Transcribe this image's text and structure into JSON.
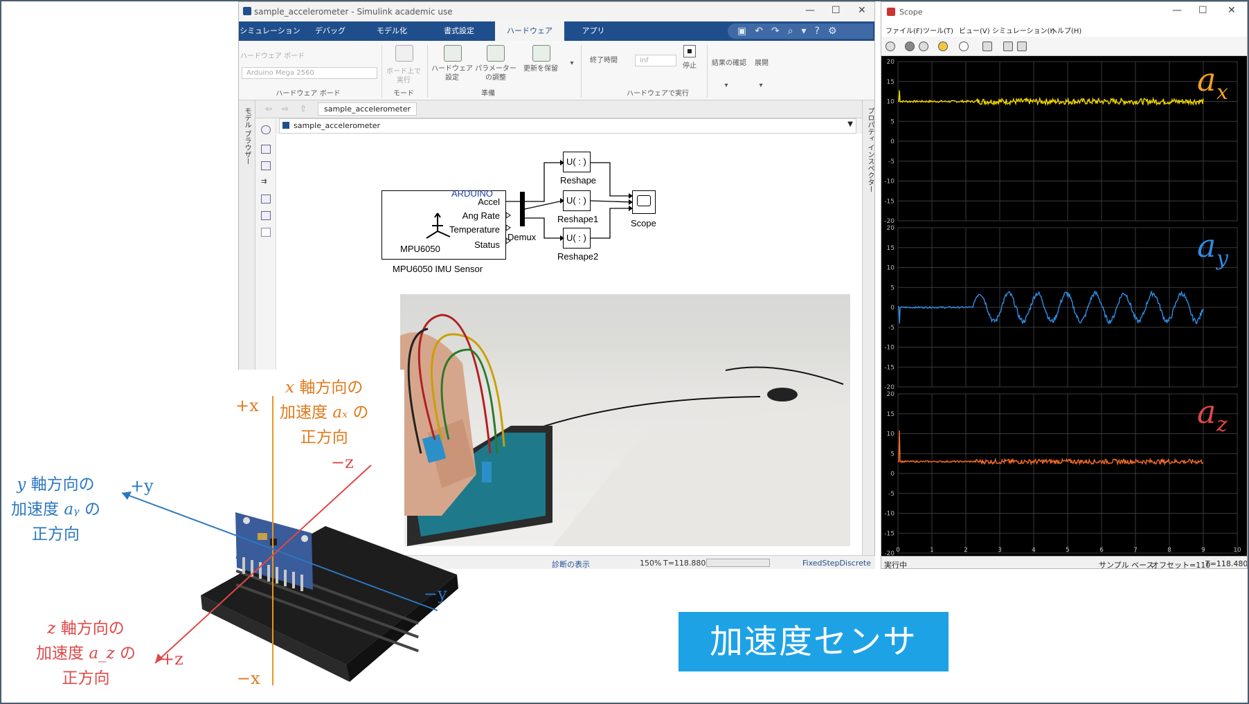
{
  "simulink": {
    "window_title": "sample_accelerometer - Simulink academic use",
    "tabs": [
      "シミュレーション",
      "デバッグ",
      "モデル化",
      "書式設定",
      "ハードウェア",
      "アプリ"
    ],
    "active_tab": "ハードウェア",
    "ribbon": {
      "hw_board_label": "ハードウェア ボード",
      "hw_board_value": "Arduino Mega 2560",
      "hw_board_section": "ハードウェア ボード",
      "run_on_board": "ボード上で実行",
      "mode_section": "モード",
      "hw_settings": "ハードウェア設定",
      "param_tune": "パラメーターの調整",
      "update_save": "更新を保留",
      "prepare_section": "準備",
      "stop_time_label": "終了時間",
      "stop_time_value": "inf",
      "stop": "停止",
      "run_on_hw_section": "ハードウェアで実行",
      "review_results": "結果の確認",
      "deploy": "展開"
    },
    "breadcrumb": "sample_accelerometer",
    "address": "sample_accelerometer",
    "left_panel": "モデル ブラウザー",
    "right_panel": "プロパティ インスペクター",
    "status": {
      "diag": "診断の表示",
      "zoom": "150%",
      "time": "T=118.880",
      "solver": "FixedStepDiscrete"
    },
    "model": {
      "sensor_brand": "ARDUINO",
      "sensor_ports": [
        "Accel",
        "Ang Rate",
        "Temperature",
        "Status"
      ],
      "sensor_inner": "MPU6050",
      "sensor_name": "MPU6050 IMU Sensor",
      "demux": "Demux",
      "reshape_text": "U( : )",
      "reshapes": [
        "Reshape",
        "Reshape1",
        "Reshape2"
      ],
      "scope": "Scope"
    }
  },
  "scope": {
    "window_title": "Scope",
    "menu": [
      "ファイル(F)",
      "ツール(T)",
      "ビュー(V)",
      "シミュレーション(I)",
      "ヘルプ(H)"
    ],
    "status": {
      "running": "実行中",
      "sample": "サンプル ベース",
      "offset": "オフセット=110",
      "time": "T=118.480"
    },
    "axis_labels": [
      "a",
      "a",
      "a"
    ],
    "axis_subs": [
      "x",
      "y",
      "z"
    ],
    "colors": {
      "ax": "#f2d600",
      "ay": "#2f8fe8",
      "az": "#f06a2a",
      "label_ax": "#f5a020",
      "label_ay": "#2e8be0",
      "label_az": "#e04848"
    }
  },
  "chart_data": [
    {
      "type": "line",
      "series": [
        {
          "name": "a_x",
          "values": [
            10,
            10,
            10,
            10,
            10,
            10,
            10,
            10,
            10,
            10
          ]
        }
      ],
      "x": [
        0,
        1,
        2,
        3,
        4,
        5,
        6,
        7,
        8,
        9
      ],
      "ylim": [
        -20,
        20
      ],
      "xlim": [
        0,
        10
      ],
      "yticks": [
        20,
        15,
        10,
        5,
        0,
        -5,
        -10,
        -15,
        -20
      ],
      "xticks": [
        0,
        1,
        2,
        3,
        4,
        5,
        6,
        7,
        8,
        9,
        10
      ],
      "grid": true
    },
    {
      "type": "line",
      "series": [
        {
          "name": "a_y",
          "values": [
            0,
            0,
            0,
            0,
            0,
            3,
            -3,
            4,
            -4,
            0
          ]
        }
      ],
      "x": [
        0,
        1,
        2,
        3,
        4,
        5,
        6,
        7,
        8,
        9
      ],
      "ylim": [
        -20,
        20
      ],
      "xlim": [
        0,
        10
      ],
      "yticks": [
        20,
        15,
        10,
        5,
        0,
        -5,
        -10,
        -15,
        -20
      ],
      "grid": true
    },
    {
      "type": "line",
      "series": [
        {
          "name": "a_z",
          "values": [
            3,
            3,
            3,
            3,
            3,
            3,
            3,
            3,
            3,
            3
          ]
        }
      ],
      "x": [
        0,
        1,
        2,
        3,
        4,
        5,
        6,
        7,
        8,
        9
      ],
      "ylim": [
        -20,
        20
      ],
      "xlim": [
        0,
        10
      ],
      "yticks": [
        20,
        15,
        10,
        5,
        0,
        -5,
        -10,
        -15,
        -20
      ],
      "grid": true
    }
  ],
  "annotations": {
    "x_l1": "軸方向の",
    "x_l2a": "加速度",
    "x_l2b": "の",
    "x_l3": "正方向",
    "y_l1": "軸方向の",
    "y_l2a": "加速度",
    "y_l2b": "の",
    "y_l3": "正方向",
    "z_l1": "軸方向の",
    "z_l2a": "加速度",
    "z_l2b": "の",
    "z_l3": "正方向",
    "plus_x": "+x",
    "minus_x": "−x",
    "plus_y": "+y",
    "minus_y": "−y",
    "plus_z": "+z",
    "minus_z": "−z",
    "var_x": "x",
    "var_y": "y",
    "var_z": "z",
    "acc_x": "aₓ",
    "acc_y": "aᵧ",
    "acc_z": "a_z"
  },
  "badge": "加速度センサ"
}
